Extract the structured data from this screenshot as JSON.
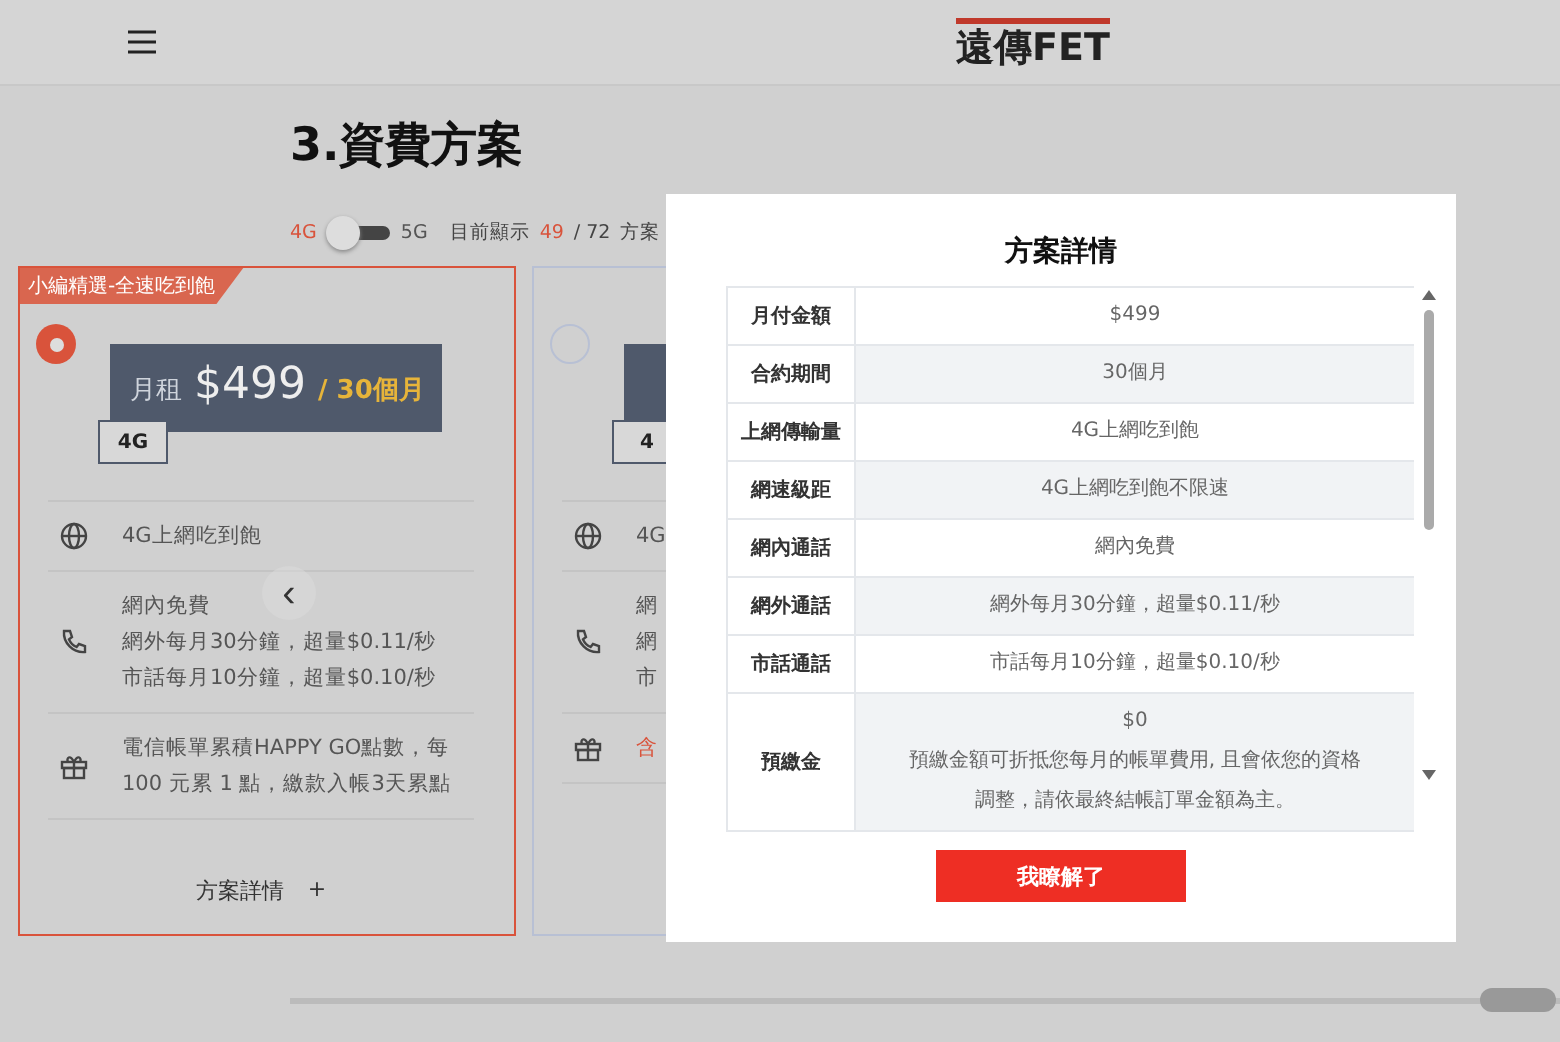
{
  "header": {
    "logo": "遠傳FET"
  },
  "page_title": "3.資費方案",
  "filter": {
    "left_label": "4G",
    "right_label": "5G",
    "five_g": false,
    "showing_label": "目前顯示",
    "count": "49",
    "total": "/ 72",
    "suffix": "方案"
  },
  "plans": [
    {
      "badge": "小編精選-全速吃到飽",
      "selected": true,
      "price_label": "月租",
      "price": "$499",
      "term": "/ 30個月",
      "network": "4G",
      "features": [
        {
          "kind": "data",
          "lines": [
            "4G上網吃到飽"
          ],
          "highlight": false
        },
        {
          "kind": "call",
          "lines": [
            "網內免費",
            "網外每月30分鐘，超量$0.11/秒",
            "市話每月10分鐘，超量$0.10/秒"
          ],
          "highlight": false
        },
        {
          "kind": "gift",
          "lines": [
            "電信帳單累積HAPPY GO點數，每 100 元累 1 點，繳款入帳3天累點"
          ],
          "highlight": false
        }
      ],
      "details_link": "方案詳情",
      "details_icon": "+"
    },
    {
      "selected": false,
      "network": "4",
      "features": [
        {
          "kind": "data",
          "lines": [
            "4G"
          ],
          "highlight": false
        },
        {
          "kind": "call",
          "lines": [
            "網",
            "網",
            "市"
          ],
          "highlight": false
        },
        {
          "kind": "gift",
          "lines": [
            "含"
          ],
          "highlight": true
        }
      ]
    }
  ],
  "carousel_prev": "‹",
  "modal": {
    "title": "方案詳情",
    "rows": [
      {
        "label": "月付金額",
        "values": [
          "$499"
        ]
      },
      {
        "label": "合約期間",
        "values": [
          "30個月"
        ]
      },
      {
        "label": "上網傳輸量",
        "values": [
          "4G上網吃到飽"
        ]
      },
      {
        "label": "網速級距",
        "values": [
          "4G上網吃到飽不限速"
        ]
      },
      {
        "label": "網內通話",
        "values": [
          "網內免費"
        ]
      },
      {
        "label": "網外通話",
        "values": [
          "網外每月30分鐘，超量$0.11/秒"
        ]
      },
      {
        "label": "市話通話",
        "values": [
          "市話每月10分鐘，超量$0.10/秒"
        ]
      },
      {
        "label": "預繳金",
        "values": [
          "$0",
          "預繳金額可折抵您每月的帳單費用, 且會依您的資格調整，請依最終結帳訂單金額為主。"
        ]
      }
    ],
    "button": "我瞭解了"
  }
}
